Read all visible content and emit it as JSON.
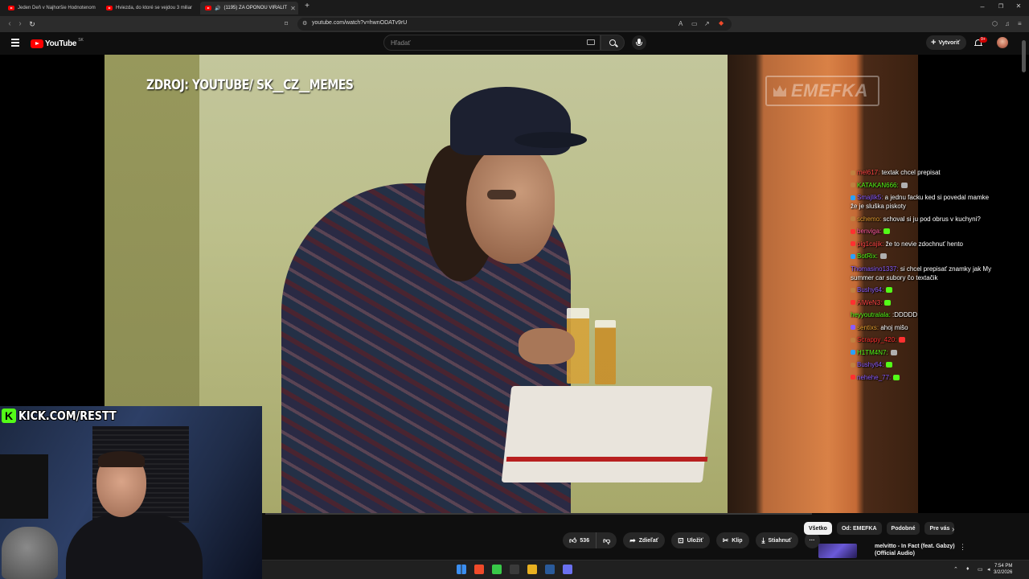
{
  "browser": {
    "tabs": [
      {
        "title": "Jeden Deň v Najhoršie Hodnotenom",
        "active": false
      },
      {
        "title": "Hviezda, do ktoré se vejdou 3 miliar",
        "active": false
      },
      {
        "title": "(1195) ZA OPONOU VIRALIT",
        "active": true
      }
    ],
    "new_tab": "+",
    "window_controls": [
      "–",
      "❐",
      "✕"
    ],
    "url": "youtube.com/watch?v=hwnODATv9rU"
  },
  "youtube": {
    "logo_text": "YouTube",
    "country": "SK",
    "search_placeholder": "Hľadať",
    "create_label": "Vytvoriť",
    "notification_count": "9+"
  },
  "video": {
    "source_caption": "ZDROJ: YOUTUBE/ SK__CZ__MEMES",
    "watermark": "EMEFKA",
    "chat": [
      {
        "user": "mel617:",
        "user_color": "#ff4444",
        "badge": "#c08040",
        "text": "textak chcel prepisat"
      },
      {
        "user": "KATAKAN666:",
        "user_color": "#53fc18",
        "badge": "#c08040",
        "text": "",
        "emote": "#b0b0b0"
      },
      {
        "user": "Smajlik5:",
        "user_color": "#8a5cff",
        "badge": "#2aa0ff",
        "text": "a jednu facku ked si povedal mamke že je sluška piskoty"
      },
      {
        "user": "schemo:",
        "user_color": "#e8a030",
        "badge": "#c08040",
        "text": "schoval si ju pod obrus v kuchyni?"
      },
      {
        "user": "benviga:",
        "user_color": "#ff5aa0",
        "badge": "#ff3030",
        "text": "",
        "emote": "#53fc18"
      },
      {
        "user": "pig1cajik:",
        "user_color": "#ff4444",
        "badge": "#ff3030",
        "text": "že to nevie zdochnuť hento"
      },
      {
        "user": "BotRix:",
        "user_color": "#53fc18",
        "badge": "#2aa0ff",
        "text": "",
        "emote": "#b0b0b0"
      },
      {
        "user": "Thomasino1337:",
        "user_color": "#8a5cff",
        "badge": "",
        "text": "si chcel prepisať znamky jak My summer car subory čo textačik"
      },
      {
        "user": "Bushy64:",
        "user_color": "#8a5cff",
        "badge": "#c08040",
        "text": "",
        "emote": "#53fc18"
      },
      {
        "user": "AiWeN3:",
        "user_color": "#ff4444",
        "badge": "#ff3030",
        "text": "",
        "emote": "#53fc18"
      },
      {
        "user": "heyyoutralala:",
        "user_color": "#53fc18",
        "badge": "",
        "text": ":DDDDD"
      },
      {
        "user": "sentixs:",
        "user_color": "#e8a030",
        "badge": "#8a5cff",
        "text": "ahoj mišo"
      },
      {
        "user": "Scrappy_420:",
        "user_color": "#ff3030",
        "badge": "#c08040",
        "text": "",
        "emote": "#ff3030"
      },
      {
        "user": "H1TM4N7:",
        "user_color": "#53fc18",
        "badge": "#2aa0ff",
        "text": "",
        "emote": "#b0b0b0"
      },
      {
        "user": "Bushy64:",
        "user_color": "#8a5cff",
        "badge": "#c08040",
        "text": "",
        "emote": "#53fc18"
      },
      {
        "user": "nehehe_77:",
        "user_color": "#8a5cff",
        "badge": "#ff3030",
        "text": "",
        "emote": "#53fc18"
      }
    ],
    "webcam_banner": "KICK.COM/RESTT",
    "webcam_k": "K"
  },
  "actions": {
    "like_count": "536",
    "share": "Zdieľať",
    "save": "Uložiť",
    "clip": "Klip",
    "download": "Stiahnuť",
    "more": "···"
  },
  "recommendations": {
    "chips": [
      {
        "label": "Všetko",
        "selected": true
      },
      {
        "label": "Od: EMEFKA",
        "selected": false
      },
      {
        "label": "Podobné",
        "selected": false
      },
      {
        "label": "Pre vás",
        "selected": false
      }
    ],
    "next": "›",
    "first_title": "melvitto - In Fact (feat. Gabzy) (Official Audio)",
    "menu": "⋮"
  },
  "taskbar": {
    "time": "7:54 PM",
    "date": "3/2/2026",
    "apps": [
      {
        "name": "windows-start",
        "color": "#3b8ef0"
      },
      {
        "name": "brave",
        "color": "#f04a2a"
      },
      {
        "name": "app-green",
        "color": "#38c848"
      },
      {
        "name": "app-x",
        "color": "#3a3a3a"
      },
      {
        "name": "chrome",
        "color": "#e8b020"
      },
      {
        "name": "steam",
        "color": "#2a5a9a"
      },
      {
        "name": "discord",
        "color": "#6a70f0"
      }
    ]
  }
}
